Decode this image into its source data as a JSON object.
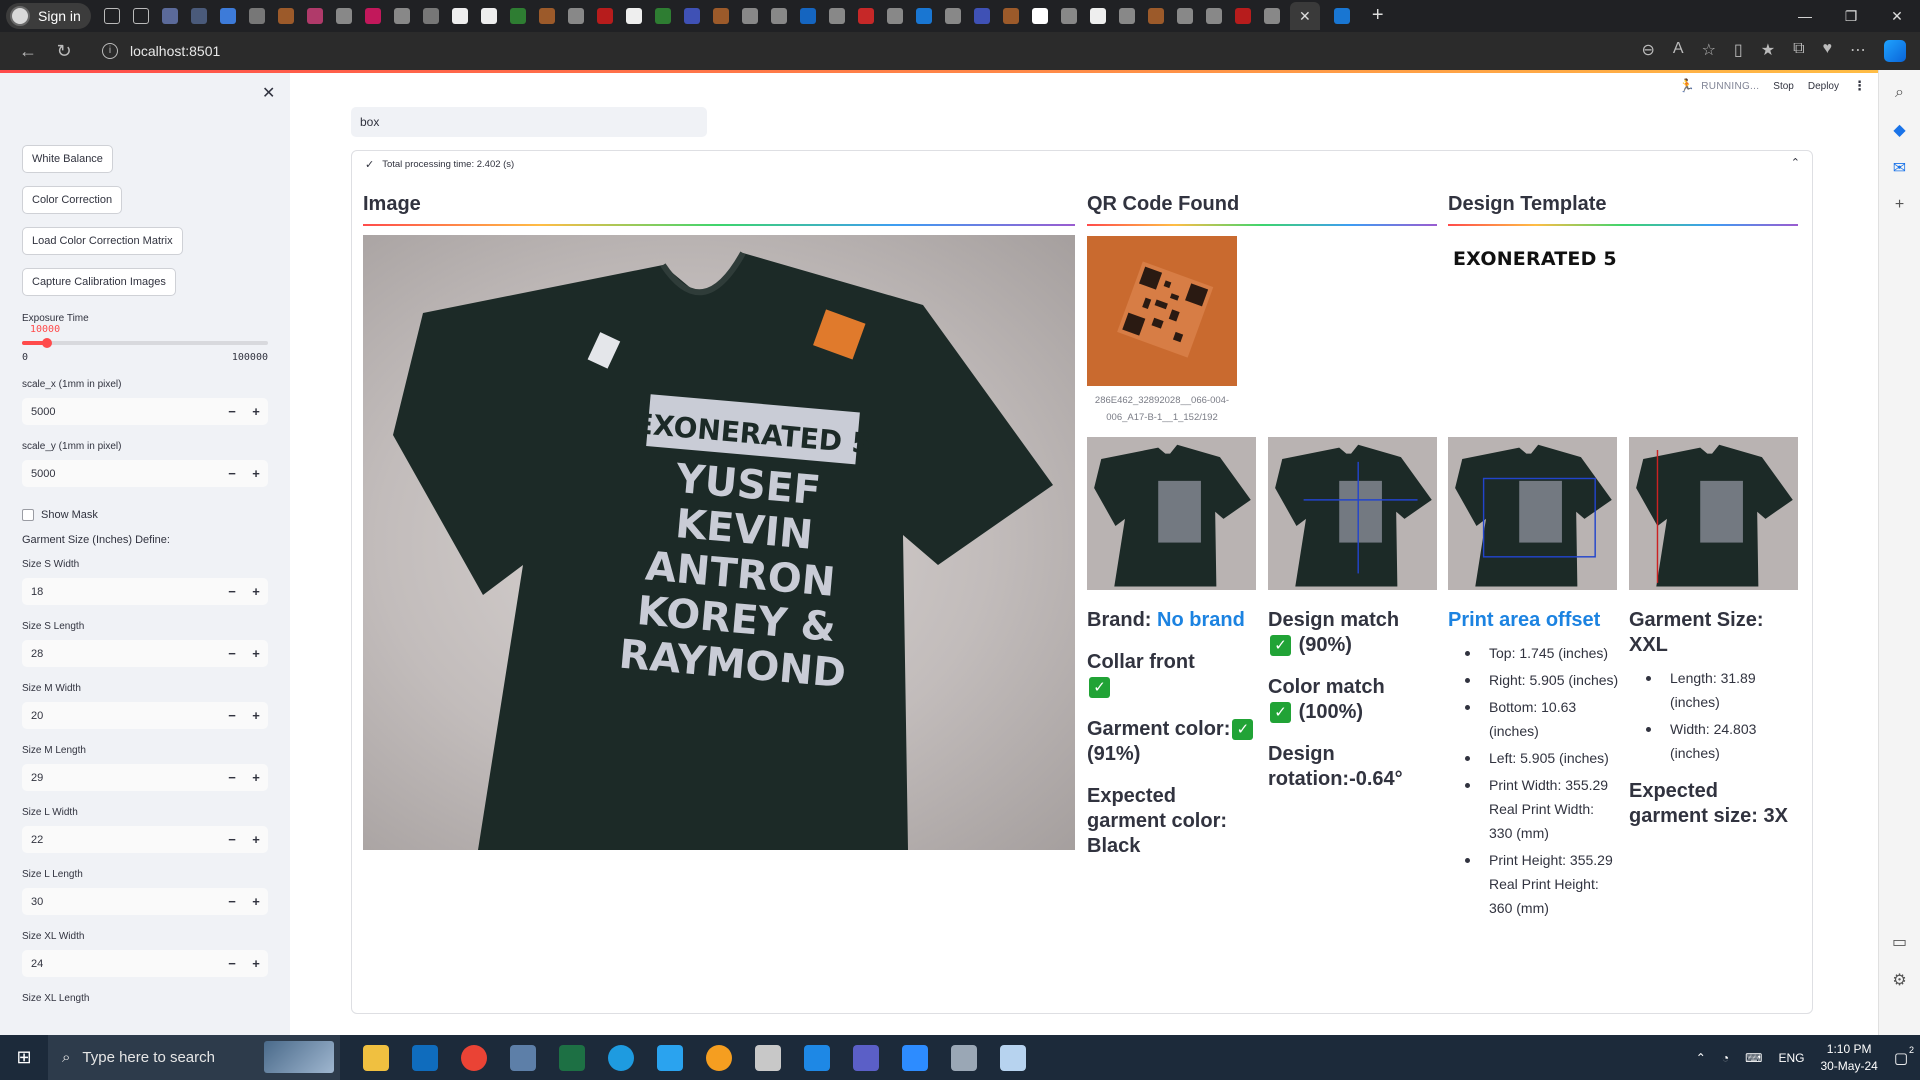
{
  "browser": {
    "profile_label": "Sign in",
    "url": "localhost:8501"
  },
  "sidebar": {
    "buttons": [
      "White Balance",
      "Color Correction",
      "Load Color Correction Matrix",
      "Capture Calibration Images"
    ],
    "exposure": {
      "label": "Exposure Time",
      "value": "10000",
      "min": "0",
      "max": "100000",
      "fraction": 0.1
    },
    "scale_x": {
      "label": "scale_x (1mm in pixel)",
      "value": "5000"
    },
    "scale_y": {
      "label": "scale_y (1mm in pixel)",
      "value": "5000"
    },
    "show_mask": {
      "label": "Show Mask",
      "checked": false
    },
    "garment_header": "Garment Size (Inches) Define:",
    "sizes": [
      {
        "label": "Size S Width",
        "value": "18"
      },
      {
        "label": "Size S Length",
        "value": "28"
      },
      {
        "label": "Size M Width",
        "value": "20"
      },
      {
        "label": "Size M Length",
        "value": "29"
      },
      {
        "label": "Size L Width",
        "value": "22"
      },
      {
        "label": "Size L Length",
        "value": "30"
      },
      {
        "label": "Size XL Width",
        "value": "24"
      }
    ],
    "last_label": "Size XL Length"
  },
  "status": {
    "running": "RUNNING...",
    "stop": "Stop",
    "deploy": "Deploy"
  },
  "search": {
    "value": "box"
  },
  "expander": {
    "label": "Total processing time: 2.402 (s)"
  },
  "columns": {
    "image": "Image",
    "qr": "QR Code Found",
    "template": "Design Template"
  },
  "qr_caption": "286E462_32892028__066-004-006_A17-B-1__1_152/192",
  "template_text": "EXONERATED 5",
  "shirt_print": {
    "banner": "EXONERATED 5",
    "lines": [
      "YUSEF",
      "KEVIN",
      "ANTRON",
      "KOREY &",
      "RAYMOND"
    ]
  },
  "results": {
    "brand_label": "Brand:",
    "brand_value": "No brand",
    "collar": "Collar front",
    "garment_color": "Garment color:",
    "garment_color_pct": "(91%)",
    "expected_color": "Expected garment color: Black",
    "design_match": "Design match",
    "design_match_pct": "(90%)",
    "color_match": "Color match",
    "color_match_pct": "(100%)",
    "design_rotation": "Design rotation:-0.64°",
    "print_offset_title": "Print area offset",
    "print_offset_items": [
      "Top: 1.745 (inches)",
      "Right: 5.905 (inches)",
      "Bottom: 10.63 (inches)",
      "Left: 5.905 (inches)",
      "Print Width: 355.29 Real Print Width: 330 (mm)",
      "Print Height: 355.29 Real Print Height: 360 (mm)"
    ],
    "garment_size": "Garment Size: XXL",
    "garment_size_items": [
      "Length: 31.89 (inches)",
      "Width: 24.803 (inches)"
    ],
    "expected_size": "Expected garment size: 3X"
  },
  "taskbar": {
    "search_placeholder": "Type here to search",
    "lang": "ENG",
    "time": "1:10 PM",
    "date": "30-May-24",
    "notif_count": "2"
  },
  "colors": {
    "accent": "#ff4b4b",
    "link_blue": "#1c83e1",
    "check_green": "#21a336",
    "sidebar_bg": "#f0f2f6"
  }
}
